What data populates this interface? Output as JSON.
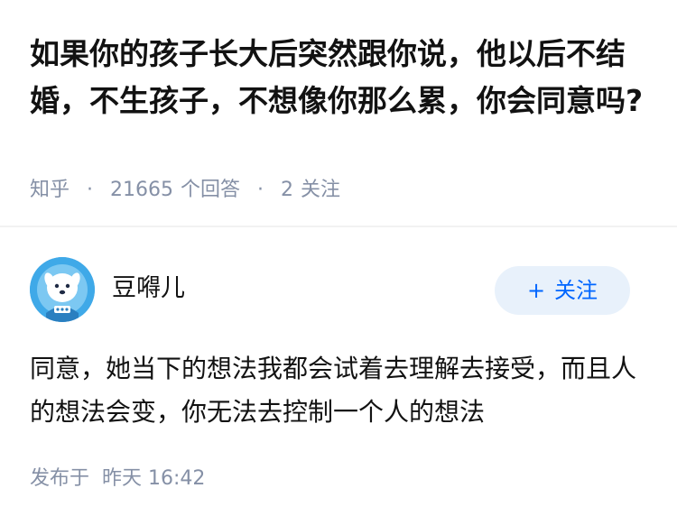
{
  "question": {
    "title": "如果你的孩子长大后突然跟你说，他以后不结婚，不生孩子，不想像你那么累，你会同意吗?",
    "source": "知乎",
    "answer_count": "21665",
    "answer_count_label": "个回答",
    "follow_count": "2",
    "follow_count_label": "关注",
    "separator": "·"
  },
  "answer": {
    "author": {
      "name": "豆嘚儿",
      "avatar_icon": "cartoon-dog-avatar-icon"
    },
    "follow_button": {
      "plus": "+",
      "label": "关注"
    },
    "content": "同意，她当下的想法我都会试着去理解去接受，而且人的想法会变，你无法去控制一个人的想法",
    "published_prefix": "发布于",
    "published_time": "昨天 16:42"
  },
  "colors": {
    "title": "#121212",
    "meta": "#8590a6",
    "accent": "#0066ff",
    "follow_bg": "#e8f1fb",
    "avatar_bg": "#3fa9e8"
  }
}
